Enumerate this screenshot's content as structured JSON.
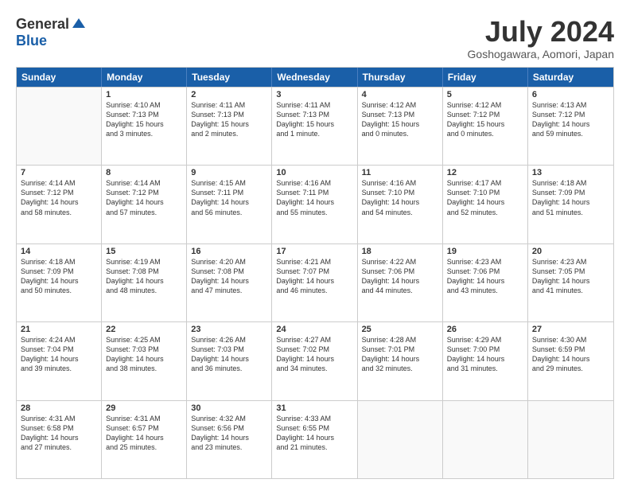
{
  "logo": {
    "general": "General",
    "blue": "Blue"
  },
  "header": {
    "month": "July 2024",
    "location": "Goshogawara, Aomori, Japan"
  },
  "days": [
    "Sunday",
    "Monday",
    "Tuesday",
    "Wednesday",
    "Thursday",
    "Friday",
    "Saturday"
  ],
  "weeks": [
    [
      {
        "day": "",
        "lines": []
      },
      {
        "day": "1",
        "lines": [
          "Sunrise: 4:10 AM",
          "Sunset: 7:13 PM",
          "Daylight: 15 hours",
          "and 3 minutes."
        ]
      },
      {
        "day": "2",
        "lines": [
          "Sunrise: 4:11 AM",
          "Sunset: 7:13 PM",
          "Daylight: 15 hours",
          "and 2 minutes."
        ]
      },
      {
        "day": "3",
        "lines": [
          "Sunrise: 4:11 AM",
          "Sunset: 7:13 PM",
          "Daylight: 15 hours",
          "and 1 minute."
        ]
      },
      {
        "day": "4",
        "lines": [
          "Sunrise: 4:12 AM",
          "Sunset: 7:13 PM",
          "Daylight: 15 hours",
          "and 0 minutes."
        ]
      },
      {
        "day": "5",
        "lines": [
          "Sunrise: 4:12 AM",
          "Sunset: 7:12 PM",
          "Daylight: 15 hours",
          "and 0 minutes."
        ]
      },
      {
        "day": "6",
        "lines": [
          "Sunrise: 4:13 AM",
          "Sunset: 7:12 PM",
          "Daylight: 14 hours",
          "and 59 minutes."
        ]
      }
    ],
    [
      {
        "day": "7",
        "lines": [
          "Sunrise: 4:14 AM",
          "Sunset: 7:12 PM",
          "Daylight: 14 hours",
          "and 58 minutes."
        ]
      },
      {
        "day": "8",
        "lines": [
          "Sunrise: 4:14 AM",
          "Sunset: 7:12 PM",
          "Daylight: 14 hours",
          "and 57 minutes."
        ]
      },
      {
        "day": "9",
        "lines": [
          "Sunrise: 4:15 AM",
          "Sunset: 7:11 PM",
          "Daylight: 14 hours",
          "and 56 minutes."
        ]
      },
      {
        "day": "10",
        "lines": [
          "Sunrise: 4:16 AM",
          "Sunset: 7:11 PM",
          "Daylight: 14 hours",
          "and 55 minutes."
        ]
      },
      {
        "day": "11",
        "lines": [
          "Sunrise: 4:16 AM",
          "Sunset: 7:10 PM",
          "Daylight: 14 hours",
          "and 54 minutes."
        ]
      },
      {
        "day": "12",
        "lines": [
          "Sunrise: 4:17 AM",
          "Sunset: 7:10 PM",
          "Daylight: 14 hours",
          "and 52 minutes."
        ]
      },
      {
        "day": "13",
        "lines": [
          "Sunrise: 4:18 AM",
          "Sunset: 7:09 PM",
          "Daylight: 14 hours",
          "and 51 minutes."
        ]
      }
    ],
    [
      {
        "day": "14",
        "lines": [
          "Sunrise: 4:18 AM",
          "Sunset: 7:09 PM",
          "Daylight: 14 hours",
          "and 50 minutes."
        ]
      },
      {
        "day": "15",
        "lines": [
          "Sunrise: 4:19 AM",
          "Sunset: 7:08 PM",
          "Daylight: 14 hours",
          "and 48 minutes."
        ]
      },
      {
        "day": "16",
        "lines": [
          "Sunrise: 4:20 AM",
          "Sunset: 7:08 PM",
          "Daylight: 14 hours",
          "and 47 minutes."
        ]
      },
      {
        "day": "17",
        "lines": [
          "Sunrise: 4:21 AM",
          "Sunset: 7:07 PM",
          "Daylight: 14 hours",
          "and 46 minutes."
        ]
      },
      {
        "day": "18",
        "lines": [
          "Sunrise: 4:22 AM",
          "Sunset: 7:06 PM",
          "Daylight: 14 hours",
          "and 44 minutes."
        ]
      },
      {
        "day": "19",
        "lines": [
          "Sunrise: 4:23 AM",
          "Sunset: 7:06 PM",
          "Daylight: 14 hours",
          "and 43 minutes."
        ]
      },
      {
        "day": "20",
        "lines": [
          "Sunrise: 4:23 AM",
          "Sunset: 7:05 PM",
          "Daylight: 14 hours",
          "and 41 minutes."
        ]
      }
    ],
    [
      {
        "day": "21",
        "lines": [
          "Sunrise: 4:24 AM",
          "Sunset: 7:04 PM",
          "Daylight: 14 hours",
          "and 39 minutes."
        ]
      },
      {
        "day": "22",
        "lines": [
          "Sunrise: 4:25 AM",
          "Sunset: 7:03 PM",
          "Daylight: 14 hours",
          "and 38 minutes."
        ]
      },
      {
        "day": "23",
        "lines": [
          "Sunrise: 4:26 AM",
          "Sunset: 7:03 PM",
          "Daylight: 14 hours",
          "and 36 minutes."
        ]
      },
      {
        "day": "24",
        "lines": [
          "Sunrise: 4:27 AM",
          "Sunset: 7:02 PM",
          "Daylight: 14 hours",
          "and 34 minutes."
        ]
      },
      {
        "day": "25",
        "lines": [
          "Sunrise: 4:28 AM",
          "Sunset: 7:01 PM",
          "Daylight: 14 hours",
          "and 32 minutes."
        ]
      },
      {
        "day": "26",
        "lines": [
          "Sunrise: 4:29 AM",
          "Sunset: 7:00 PM",
          "Daylight: 14 hours",
          "and 31 minutes."
        ]
      },
      {
        "day": "27",
        "lines": [
          "Sunrise: 4:30 AM",
          "Sunset: 6:59 PM",
          "Daylight: 14 hours",
          "and 29 minutes."
        ]
      }
    ],
    [
      {
        "day": "28",
        "lines": [
          "Sunrise: 4:31 AM",
          "Sunset: 6:58 PM",
          "Daylight: 14 hours",
          "and 27 minutes."
        ]
      },
      {
        "day": "29",
        "lines": [
          "Sunrise: 4:31 AM",
          "Sunset: 6:57 PM",
          "Daylight: 14 hours",
          "and 25 minutes."
        ]
      },
      {
        "day": "30",
        "lines": [
          "Sunrise: 4:32 AM",
          "Sunset: 6:56 PM",
          "Daylight: 14 hours",
          "and 23 minutes."
        ]
      },
      {
        "day": "31",
        "lines": [
          "Sunrise: 4:33 AM",
          "Sunset: 6:55 PM",
          "Daylight: 14 hours",
          "and 21 minutes."
        ]
      },
      {
        "day": "",
        "lines": []
      },
      {
        "day": "",
        "lines": []
      },
      {
        "day": "",
        "lines": []
      }
    ]
  ]
}
